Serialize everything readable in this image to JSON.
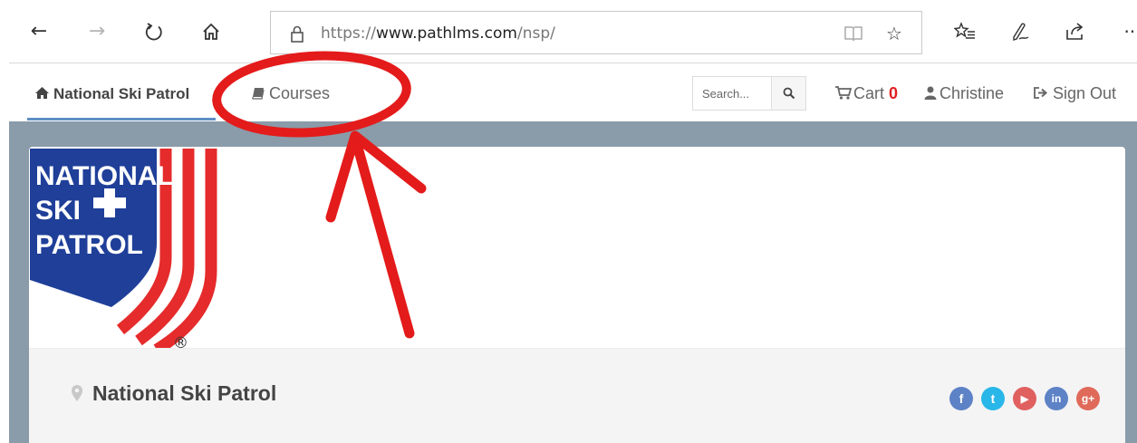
{
  "browser": {
    "url_scheme": "https://",
    "url_host": "www.pathlms.com",
    "url_path": "/nsp/",
    "icons": [
      "back-icon",
      "forward-icon",
      "refresh-icon",
      "home-icon",
      "lock-icon",
      "reading-view-icon",
      "star-icon",
      "favorites-icon",
      "pen-icon",
      "share-icon",
      "more-icon"
    ]
  },
  "navbar": {
    "brand_label": "National Ski Patrol",
    "courses_label": "Courses",
    "search_placeholder": "Search...",
    "cart_label": "Cart",
    "cart_count": "0",
    "user_label": "Christine",
    "signout_label": "Sign Out"
  },
  "logo": {
    "line1": "NATIONAL",
    "line2": "SKI",
    "line3": "PATROL",
    "registered": "®"
  },
  "org": {
    "title": "National Ski Patrol"
  },
  "social": [
    {
      "name": "facebook",
      "glyph": "f",
      "color": "#5d82c6"
    },
    {
      "name": "twitter",
      "glyph": "t",
      "color": "#29b6e8"
    },
    {
      "name": "youtube",
      "glyph": "▶",
      "color": "#e06060"
    },
    {
      "name": "linkedin",
      "glyph": "in",
      "color": "#5d82c6"
    },
    {
      "name": "google-plus",
      "glyph": "g+",
      "color": "#e06a5a"
    }
  ],
  "colors": {
    "accent_blue": "#5f8ec5",
    "cart_red": "#e02020",
    "page_bg": "#8a9ba9",
    "annotation_red": "#e41b1b",
    "logo_blue": "#1f3f99",
    "logo_red": "#e52b2b"
  }
}
